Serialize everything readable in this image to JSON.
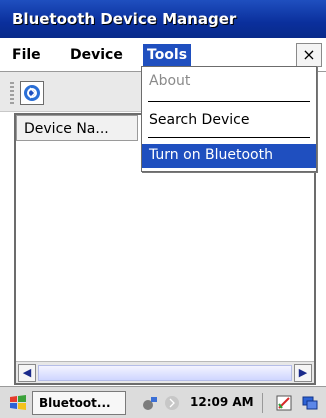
{
  "window": {
    "title": "Bluetooth Device Manager"
  },
  "menubar": {
    "items": [
      {
        "label": "File"
      },
      {
        "label": "Device"
      },
      {
        "label": "Tools"
      }
    ],
    "close_label": "×"
  },
  "toolbar": {
    "icon": "bluetooth-app-icon"
  },
  "list": {
    "columns": [
      "Device Na..."
    ]
  },
  "tools_menu": {
    "items": [
      {
        "label": "About",
        "disabled": true
      },
      {
        "label": "Search Device",
        "disabled": false
      },
      {
        "label": "Turn on Bluetooth",
        "disabled": false,
        "selected": true
      }
    ]
  },
  "taskbar": {
    "task_label": "Bluetoot...",
    "clock": "12:09 AM",
    "icons": [
      "windows-flag-icon",
      "network-icon",
      "bluetooth-tray-icon",
      "pen-icon",
      "window-switch-icon"
    ]
  },
  "colors": {
    "accent": "#1f4fbf"
  }
}
